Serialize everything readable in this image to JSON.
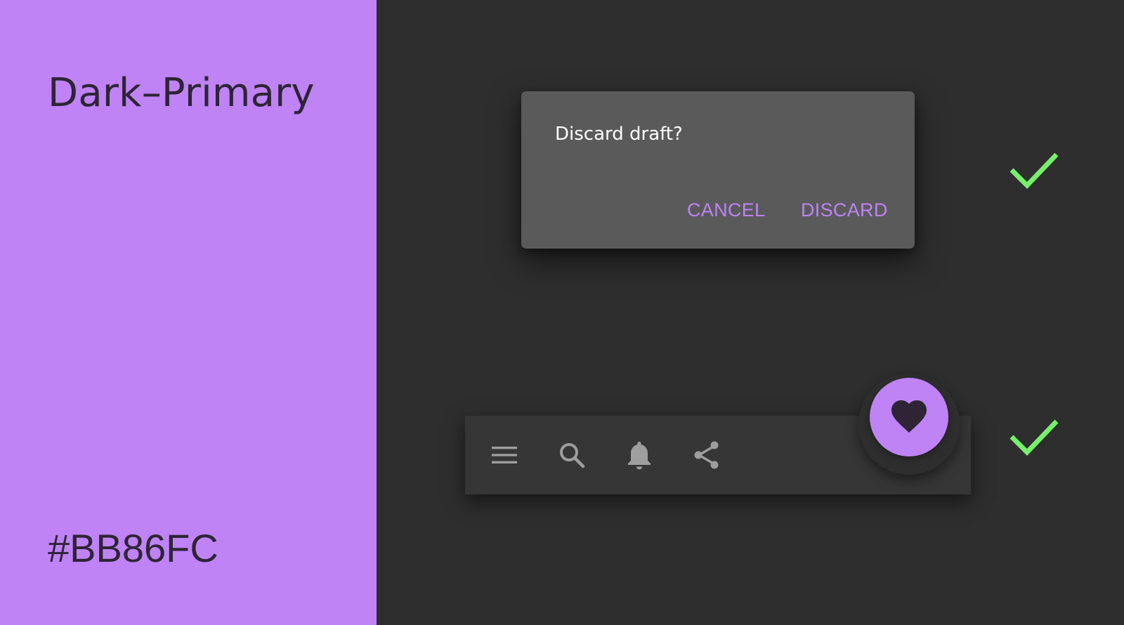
{
  "swatch": {
    "title": "Dark–Primary",
    "hex": "#BB86FC",
    "background_color": "#BB86FC"
  },
  "dialog": {
    "title": "Discard draft?",
    "cancel_label": "CANCEL",
    "discard_label": "DISCARD",
    "surface_color": "#5A5A5A",
    "accent_color": "#BB86FC"
  },
  "appbar": {
    "icons": [
      "menu-icon",
      "search-icon",
      "bell-icon",
      "share-icon"
    ],
    "icon_color": "#9E9E9E"
  },
  "fab": {
    "icon": "heart-icon",
    "color": "#BB86FC"
  },
  "checks": {
    "icon": "check-icon",
    "color": "#76F06A"
  }
}
